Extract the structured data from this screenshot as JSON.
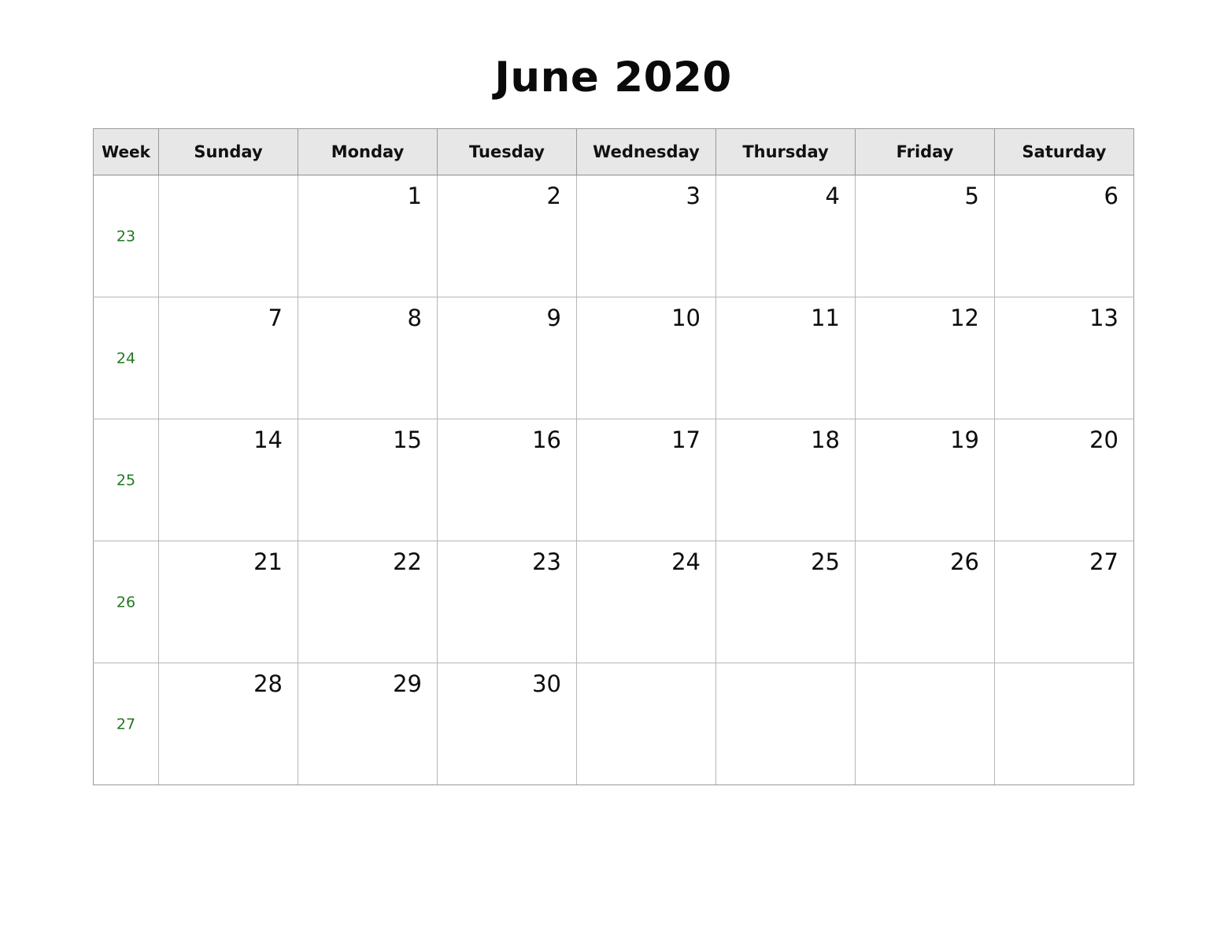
{
  "title": "June 2020",
  "colors": {
    "week_number": "#217821",
    "header_bg": "#e7e7e7",
    "grid_line": "#b6b6b6",
    "outer_line": "#9a9a9a",
    "text": "#0d0d0d",
    "page_bg": "#ffffff"
  },
  "header": {
    "week_label": "Week",
    "days": [
      "Sunday",
      "Monday",
      "Tuesday",
      "Wednesday",
      "Thursday",
      "Friday",
      "Saturday"
    ]
  },
  "weeks": [
    {
      "week_number": "23",
      "days": [
        "",
        "1",
        "2",
        "3",
        "4",
        "5",
        "6"
      ]
    },
    {
      "week_number": "24",
      "days": [
        "7",
        "8",
        "9",
        "10",
        "11",
        "12",
        "13"
      ]
    },
    {
      "week_number": "25",
      "days": [
        "14",
        "15",
        "16",
        "17",
        "18",
        "19",
        "20"
      ]
    },
    {
      "week_number": "26",
      "days": [
        "21",
        "22",
        "23",
        "24",
        "25",
        "26",
        "27"
      ]
    },
    {
      "week_number": "27",
      "days": [
        "28",
        "29",
        "30",
        "",
        "",
        "",
        ""
      ]
    }
  ]
}
